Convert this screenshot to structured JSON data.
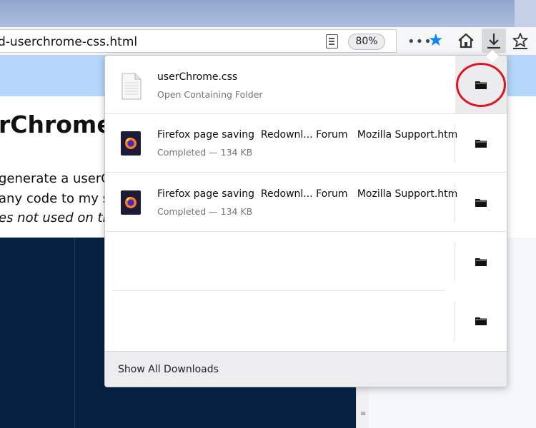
{
  "toolbar": {
    "url_text": "d-userchrome-css.html",
    "zoom": "80%",
    "meatball_label": "•••",
    "accent_color": "#0a84ff"
  },
  "page": {
    "heading": "rChrome",
    "lines": [
      "generate a userCh",
      "any code to my se",
      "es not used on the u"
    ],
    "banner_color": "#b4d7fb",
    "dark_color": "#062243"
  },
  "downloads": {
    "items": [
      {
        "name": "userChrome.css",
        "status": "Open Containing Folder",
        "icon": "file-icon"
      },
      {
        "name": "Firefox page saving  Redownl... Forum   Mozilla Support.htm",
        "status": "Completed — 134 KB",
        "icon": "firefox-icon"
      },
      {
        "name": "Firefox page saving  Redownl... Forum   Mozilla Support.htm",
        "status": "Completed — 134 KB",
        "icon": "firefox-icon"
      },
      {
        "name": "",
        "status": "",
        "icon": ""
      },
      {
        "name": "",
        "status": "",
        "icon": ""
      }
    ],
    "footer": "Show All Downloads",
    "highlight_color": "#e0161f"
  }
}
